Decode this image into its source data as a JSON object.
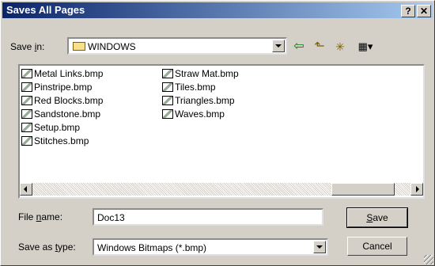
{
  "window": {
    "title": "Saves All Pages",
    "help_btn": "?",
    "close_btn": "✕"
  },
  "save_in": {
    "label_pre": "Save ",
    "label_u": "i",
    "label_post": "n:",
    "value": "WINDOWS"
  },
  "toolbar": {
    "back": "⇦",
    "up": "⬑",
    "new_folder": "✳",
    "views": "▦▾"
  },
  "files": [
    "Metal Links.bmp",
    "Pinstripe.bmp",
    "Red Blocks.bmp",
    "Sandstone.bmp",
    "Setup.bmp",
    "Stitches.bmp",
    "Straw Mat.bmp",
    "Tiles.bmp",
    "Triangles.bmp",
    "Waves.bmp"
  ],
  "file_name": {
    "label_pre": "File ",
    "label_u": "n",
    "label_post": "ame:",
    "value": "Doc13"
  },
  "save_as_type": {
    "label_pre": "Save as ",
    "label_u": "t",
    "label_post": "ype:",
    "value": "Windows Bitmaps (*.bmp)"
  },
  "buttons": {
    "save_u": "S",
    "save_rest": "ave",
    "cancel": "Cancel"
  }
}
